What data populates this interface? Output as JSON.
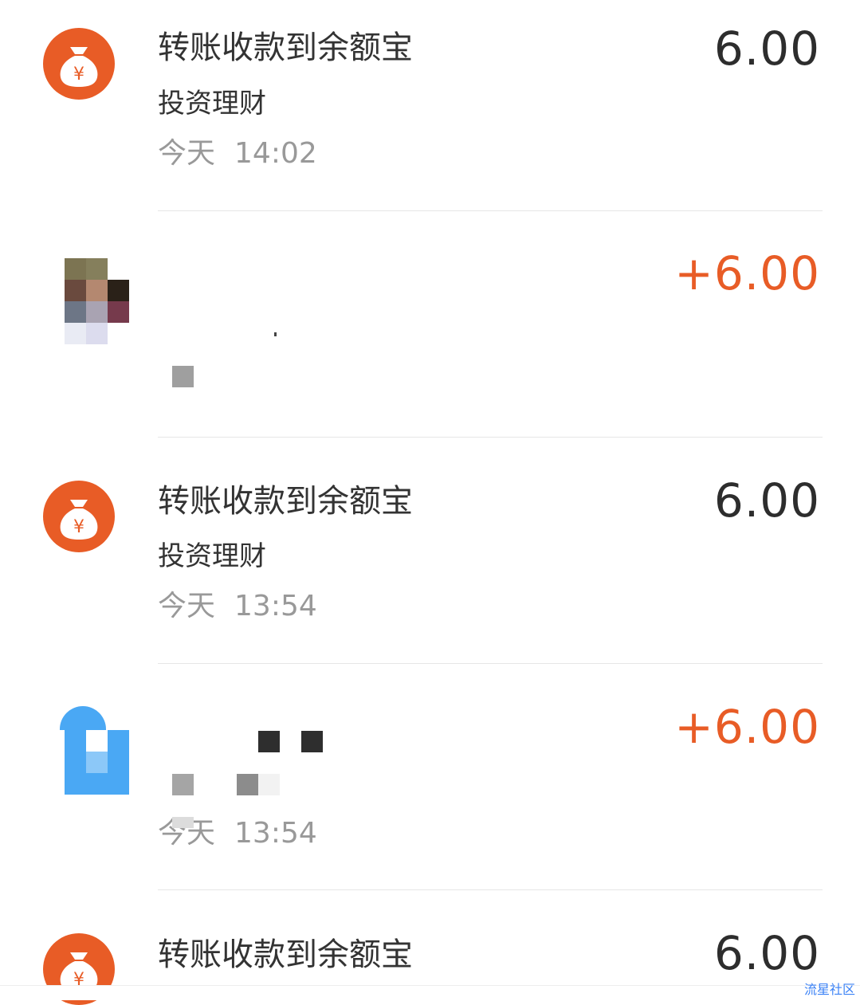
{
  "transactions": [
    {
      "title": "转账收款到余额宝",
      "category": "投资理财",
      "day": "今天",
      "time": "14:02",
      "amount": "6.00",
      "icon": "money-bag-icon"
    },
    {
      "title": "",
      "category": "",
      "day": "",
      "time": "",
      "amount": "+6.00",
      "icon": "user-avatar-pixelated"
    },
    {
      "title": "转账收款到余额宝",
      "category": "投资理财",
      "day": "今天",
      "time": "13:54",
      "amount": "6.00",
      "icon": "money-bag-icon"
    },
    {
      "title": "",
      "category": "",
      "day": "今天",
      "time": "13:54",
      "amount": "+6.00",
      "icon": "app-logo-pixelated"
    },
    {
      "title": "转账收款到余额宝",
      "amount": "6.00",
      "icon": "money-bag-icon"
    }
  ],
  "colors": {
    "income": "#e85c26",
    "neutral": "#2d2d2d",
    "icon_bg": "#e85c26",
    "muted": "#999999"
  },
  "watermark": "流星社区"
}
